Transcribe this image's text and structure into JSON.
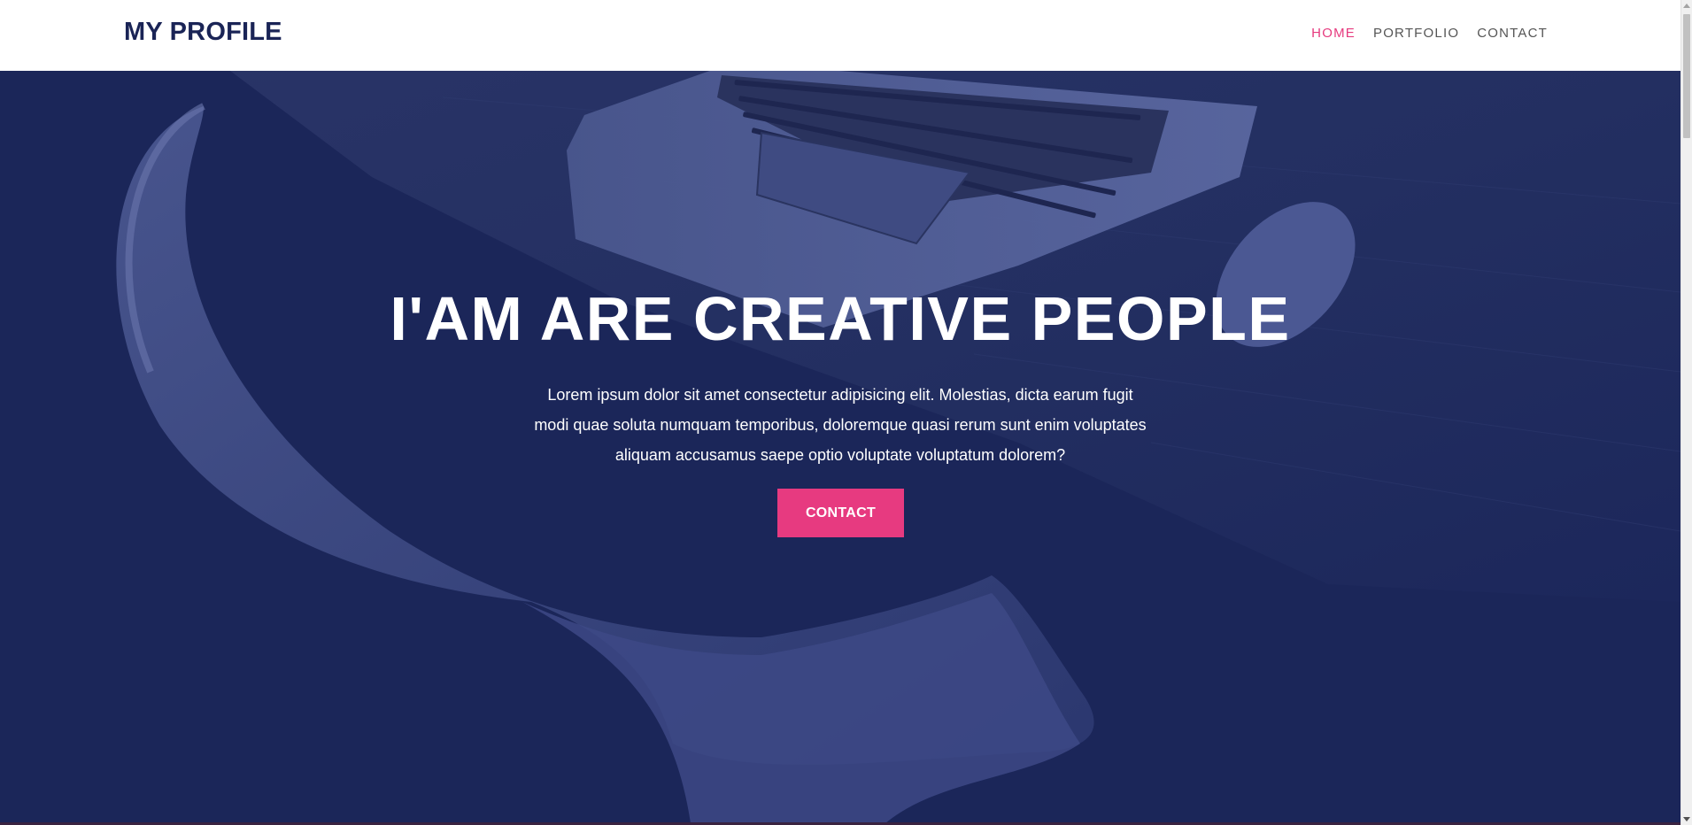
{
  "brand": {
    "title": "MY PROFILE"
  },
  "nav": {
    "items": [
      {
        "label": "HOME",
        "active": true
      },
      {
        "label": "PORTFOLIO",
        "active": false
      },
      {
        "label": "CONTACT",
        "active": false
      }
    ]
  },
  "hero": {
    "title": "I'AM ARE CREATIVE PEOPLE",
    "text": "Lorem ipsum dolor sit amet consectetur adipisicing elit. Molestias, dicta earum fugit modi quae soluta numquam temporibus, doloremque quasi rerum sunt enim voluptates aliquam accusamus saepe optio voluptate voluptatum dolorem?",
    "cta_label": "CONTACT",
    "background_image": "laptop-chair-desk-photo"
  },
  "colors": {
    "brand": "#1a2456",
    "accent": "#e63a7e",
    "overlay": "#1b2659",
    "nav_text": "#555555"
  }
}
